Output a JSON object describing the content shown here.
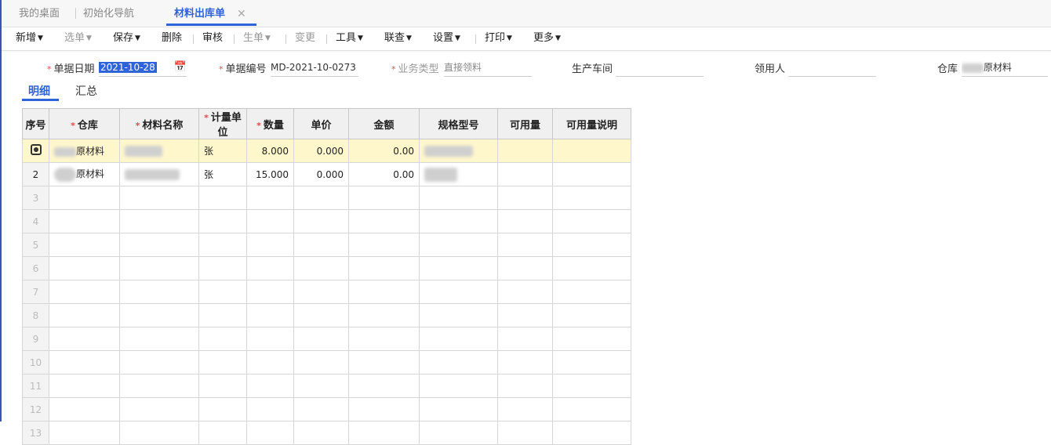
{
  "tabs": [
    {
      "label": "我的桌面",
      "active": false
    },
    {
      "label": "初始化导航",
      "active": false
    },
    {
      "label": "材料出库单",
      "active": true
    }
  ],
  "toolbar": {
    "items": [
      {
        "label": "新增",
        "dropdown": true,
        "disabled": false
      },
      {
        "label": "选单",
        "dropdown": true,
        "disabled": true
      },
      {
        "label": "保存",
        "dropdown": true,
        "disabled": false
      },
      {
        "label": "删除",
        "dropdown": false,
        "disabled": false
      },
      {
        "label": "审核",
        "dropdown": false,
        "disabled": false
      },
      {
        "label": "生单",
        "dropdown": true,
        "disabled": true
      },
      {
        "label": "变更",
        "dropdown": false,
        "disabled": true
      },
      {
        "label": "工具",
        "dropdown": true,
        "disabled": false
      },
      {
        "label": "联查",
        "dropdown": true,
        "disabled": false
      },
      {
        "label": "设置",
        "dropdown": true,
        "disabled": false
      },
      {
        "label": "打印",
        "dropdown": true,
        "disabled": false
      },
      {
        "label": "更多",
        "dropdown": true,
        "disabled": false
      }
    ]
  },
  "form": {
    "date_label": "单据日期",
    "date_value": "2021-10-28",
    "code_label": "单据编号",
    "code_value": "MD-2021-10-0273",
    "biz_type_label": "业务类型",
    "biz_type_value": "直接领料",
    "workshop_label": "生产车间",
    "workshop_value": "",
    "receiver_label": "领用人",
    "receiver_value": "",
    "warehouse_label": "仓库",
    "warehouse_value": "原材料"
  },
  "subtabs": [
    {
      "label": "明细",
      "active": true
    },
    {
      "label": "汇总",
      "active": false
    }
  ],
  "table": {
    "columns": [
      {
        "label": "序号",
        "required": false
      },
      {
        "label": "仓库",
        "required": true
      },
      {
        "label": "材料名称",
        "required": true
      },
      {
        "label": "计量单位",
        "required": true
      },
      {
        "label": "数量",
        "required": true
      },
      {
        "label": "单价",
        "required": false
      },
      {
        "label": "金额",
        "required": false
      },
      {
        "label": "规格型号",
        "required": false
      },
      {
        "label": "可用量",
        "required": false
      },
      {
        "label": "可用量说明",
        "required": false
      }
    ],
    "rows": [
      {
        "idx": "",
        "warehouse": "原材料",
        "unit": "张",
        "qty": "8.000",
        "price": "0.000",
        "amount": "0.00"
      },
      {
        "idx": "2",
        "warehouse": "原材料",
        "unit": "张",
        "qty": "15.000",
        "price": "0.000",
        "amount": "0.00"
      }
    ],
    "empty_rows": [
      "3",
      "4",
      "5",
      "6",
      "7",
      "8",
      "9",
      "10",
      "11",
      "12",
      "13"
    ]
  },
  "colors": {
    "accent": "#2f63d8",
    "required": "#e5484d",
    "selected_row": "#fff7cc"
  }
}
